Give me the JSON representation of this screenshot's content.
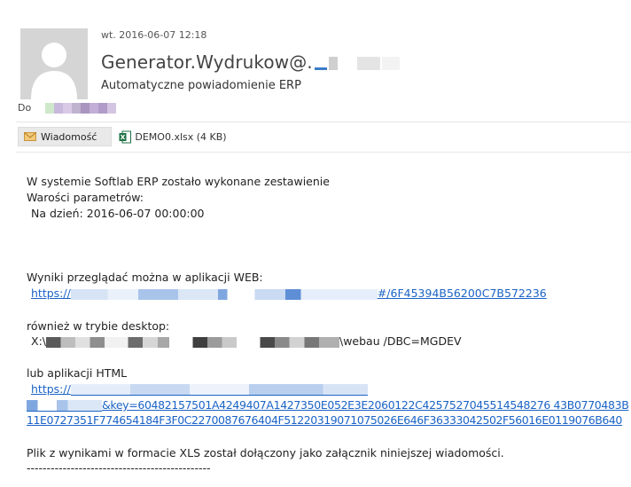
{
  "header": {
    "date": "wt. 2016-06-07 12:18",
    "sender": "Generator.Wydrukow@.",
    "subject": "Automatyczne powiadomienie ERP",
    "to_label": "Do"
  },
  "attachments": {
    "message_tab": "Wiadomość",
    "file_name": "DEMO0.xlsx (4 KB)"
  },
  "body": {
    "intro": "W systemie Softlab ERP zostało wykonane zestawienie",
    "params_label": "Warości parametrów:",
    "param_date": "Na dzień: 2016-06-07 00:00:00",
    "web_label": "Wyniki przeglądać można w aplikacji WEB:",
    "web_link_start": "https://",
    "web_link_end": "#/6F45394B56200C7B572236",
    "desktop_label": "również w trybie desktop:",
    "desktop_start": "X:\\",
    "desktop_end": "\\webau /DBC=MGDEV",
    "html_label": "lub aplikacji HTML",
    "html_link_start": "https://",
    "html_link_key": "&key=60482157501A4249407A1427350E052E3E2060122C4257527045514548276 43B0770483B",
    "html_link_line2": "11E0727351F774654184F3F0C2270087676404F51220319071075026E646F36333042502F56016E0119076B640",
    "footer_note": "Plik z wynikami w formacie XLS został dołączony jako załącznik niniejszej wiadomości.",
    "separator": "----------------------------------------------"
  }
}
